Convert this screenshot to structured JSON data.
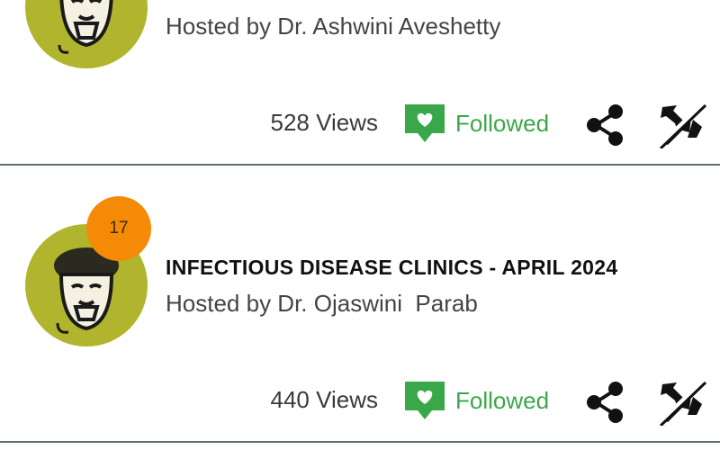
{
  "items": [
    {
      "title": "",
      "host": "Hosted by Dr. Ashwini Aveshetty",
      "badge": "",
      "views": "528 Views",
      "follow_label": "Followed"
    },
    {
      "title": "INFECTIOUS DISEASE CLINICS - APRIL 2024",
      "host": "Hosted by Dr. Ojaswini  Parab",
      "badge": "17",
      "views": "440 Views",
      "follow_label": "Followed"
    }
  ],
  "icons": {
    "avatar": "doctor-avatar-icon",
    "follow": "heart-speech-bubble-icon",
    "share": "share-icon",
    "unpin": "unpin-icon"
  },
  "colors": {
    "avatar_bg": "#b1b52d",
    "badge_bg": "#f58a07",
    "followed_green": "#3aa84a",
    "divider": "#5f6f6c"
  }
}
